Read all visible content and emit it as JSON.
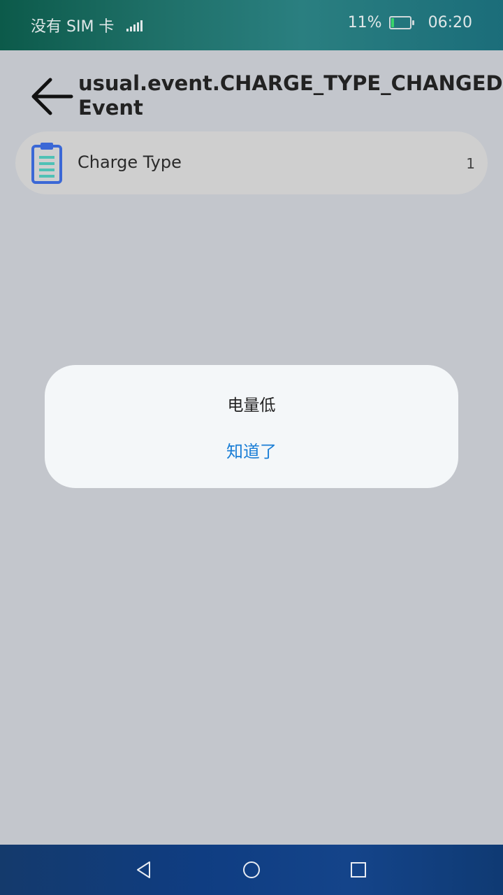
{
  "status_bar": {
    "carrier": "没有 SIM 卡",
    "battery_percent": "11%",
    "battery_level": 0.11,
    "time": "06:20"
  },
  "header": {
    "back_icon": "arrow-left-icon",
    "title": "usual.event.CHARGE_TYPE_CHANGED Event"
  },
  "list": {
    "items": [
      {
        "icon": "clipboard-icon",
        "label": "Charge Type",
        "value": "1"
      }
    ]
  },
  "dialog": {
    "message": "电量低",
    "confirm_label": "知道了"
  },
  "nav_bar": {
    "back_icon": "triangle-back-icon",
    "home_icon": "circle-home-icon",
    "recents_icon": "square-recents-icon"
  },
  "colors": {
    "accent": "#1a7ed6",
    "background": "#c3c6cc",
    "dialog_background": "#f4f7f9"
  }
}
